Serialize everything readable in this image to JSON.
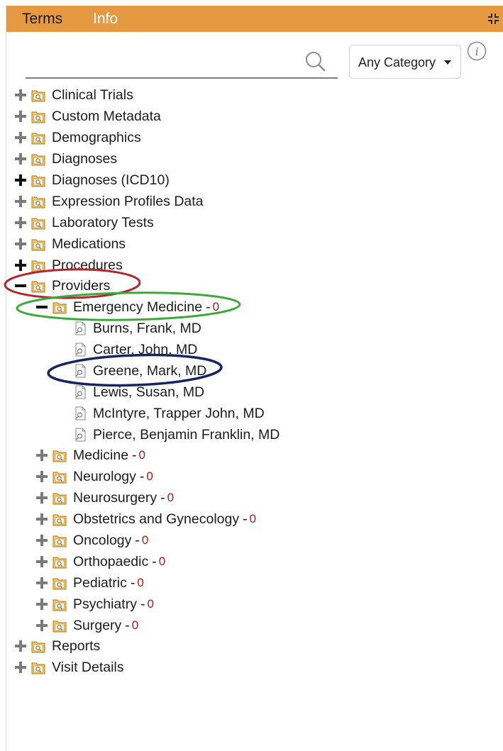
{
  "tabs": {
    "terms": "Terms",
    "info": "Info"
  },
  "search": {
    "value": "",
    "placeholder": ""
  },
  "category": {
    "selected": "Any Category"
  },
  "tree": {
    "clinical_trials": "Clinical Trials",
    "custom_metadata": "Custom Metadata",
    "demographics": "Demographics",
    "diagnoses": "Diagnoses",
    "diagnoses_icd10": "Diagnoses (ICD10)",
    "expression_profiles": "Expression Profiles Data",
    "laboratory_tests": "Laboratory Tests",
    "medications": "Medications",
    "procedures": "Procedures",
    "providers": "Providers",
    "emergency_medicine": {
      "label": "Emergency Medicine",
      "count": "0"
    },
    "doctors": [
      "Burns, Frank, MD",
      "Carter, John, MD",
      "Greene, Mark, MD",
      "Lewis, Susan, MD",
      "McIntyre, Trapper John, MD",
      "Pierce, Benjamin Franklin, MD"
    ],
    "departments": [
      {
        "label": "Medicine",
        "count": "0"
      },
      {
        "label": "Neurology",
        "count": "0"
      },
      {
        "label": "Neurosurgery",
        "count": "0"
      },
      {
        "label": "Obstetrics and Gynecology",
        "count": "0"
      },
      {
        "label": "Oncology",
        "count": "0"
      },
      {
        "label": "Orthopaedic",
        "count": "0"
      },
      {
        "label": "Pediatric",
        "count": "0"
      },
      {
        "label": "Psychiatry",
        "count": "0"
      },
      {
        "label": "Surgery",
        "count": "0"
      }
    ],
    "reports": "Reports",
    "visit_details": "Visit Details"
  },
  "colors": {
    "header": "#e59a42",
    "count": "#b01818",
    "annotation_red": "#b3262c",
    "annotation_green": "#3da83b",
    "annotation_blue": "#17245e"
  }
}
